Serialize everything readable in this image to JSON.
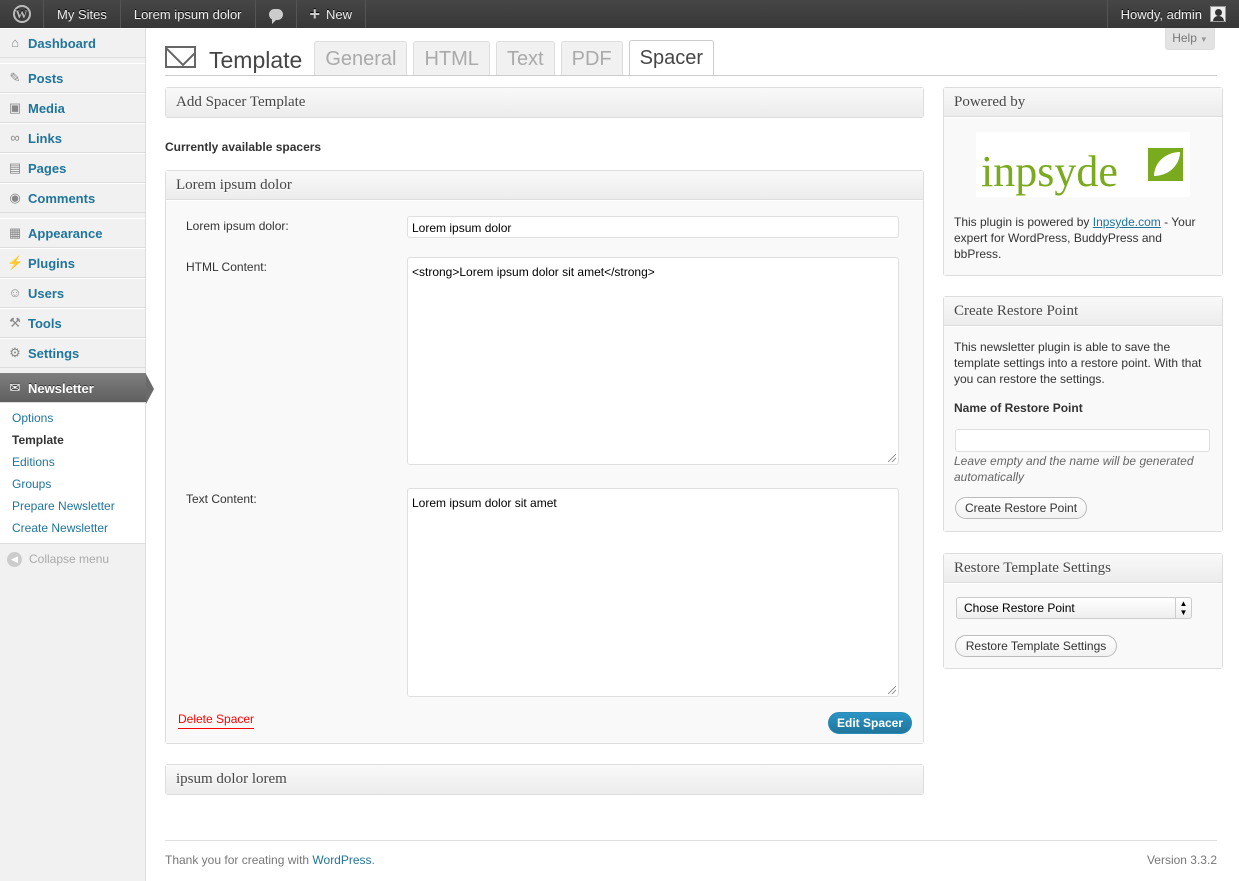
{
  "adminbar": {
    "logo_icon": "wordpress-logo-icon",
    "my_sites": "My Sites",
    "site_name": "Lorem ipsum dolor",
    "comments_icon": "comment-bubble-icon",
    "new_label": "New",
    "howdy": "Howdy, admin"
  },
  "sidebar": {
    "items": [
      {
        "label": "Dashboard",
        "icon": "dashboard-icon"
      },
      {
        "label": "Posts",
        "icon": "pushpin-icon"
      },
      {
        "label": "Media",
        "icon": "media-icon"
      },
      {
        "label": "Links",
        "icon": "link-icon"
      },
      {
        "label": "Pages",
        "icon": "pages-icon"
      },
      {
        "label": "Comments",
        "icon": "comments-icon"
      },
      {
        "label": "Appearance",
        "icon": "appearance-icon"
      },
      {
        "label": "Plugins",
        "icon": "plugin-icon"
      },
      {
        "label": "Users",
        "icon": "users-icon"
      },
      {
        "label": "Tools",
        "icon": "tools-icon"
      },
      {
        "label": "Settings",
        "icon": "settings-icon"
      },
      {
        "label": "Newsletter",
        "icon": "envelope-icon"
      }
    ],
    "submenu": [
      "Options",
      "Template",
      "Editions",
      "Groups",
      "Prepare Newsletter",
      "Create Newsletter"
    ],
    "collapse": "Collapse menu"
  },
  "header": {
    "title": "Template",
    "tabs": [
      "General",
      "HTML",
      "Text",
      "PDF",
      "Spacer"
    ],
    "active_tab": "Spacer",
    "help": "Help"
  },
  "main": {
    "add_spacer_title": "Add Spacer Template",
    "currently_available": "Currently available spacers",
    "spacer_box": {
      "title": "Lorem ipsum dolor",
      "name_label": "Lorem ipsum dolor:",
      "name_value": "Lorem ipsum dolor",
      "html_label": "HTML Content:",
      "html_value": "<strong>Lorem ipsum dolor sit amet</strong>",
      "text_label": "Text Content:",
      "text_value": "Lorem ipsum dolor sit amet",
      "delete_link": "Delete Spacer",
      "edit_button": "Edit Spacer"
    },
    "second_box_title": "ipsum dolor lorem"
  },
  "side": {
    "powered": {
      "title": "Powered by",
      "logo_text": "inpsyde",
      "text_before": "This plugin is powered by ",
      "link": "Inpsyde.com",
      "text_after": " - Your expert for WordPress, BuddyPress and bbPress."
    },
    "restore_point": {
      "title": "Create Restore Point",
      "description": "This newsletter plugin is able to save the template settings into a restore point. With that you can restore the settings.",
      "name_label": "Name of Restore Point",
      "input_value": "",
      "hint": "Leave empty and the name will be generated automatically",
      "button": "Create Restore Point"
    },
    "restore_settings": {
      "title": "Restore Template Settings",
      "select_value": "Chose Restore Point",
      "button": "Restore Template Settings"
    }
  },
  "footer": {
    "thanks_prefix": "Thank you for creating with ",
    "wordpress_link": "WordPress",
    "thanks_suffix": ".",
    "version": "Version 3.3.2"
  },
  "colors": {
    "link": "#21759b",
    "delete": "#ff0000",
    "brand_green": "#7aaa1d",
    "active_menu": "#6a6a6a"
  }
}
